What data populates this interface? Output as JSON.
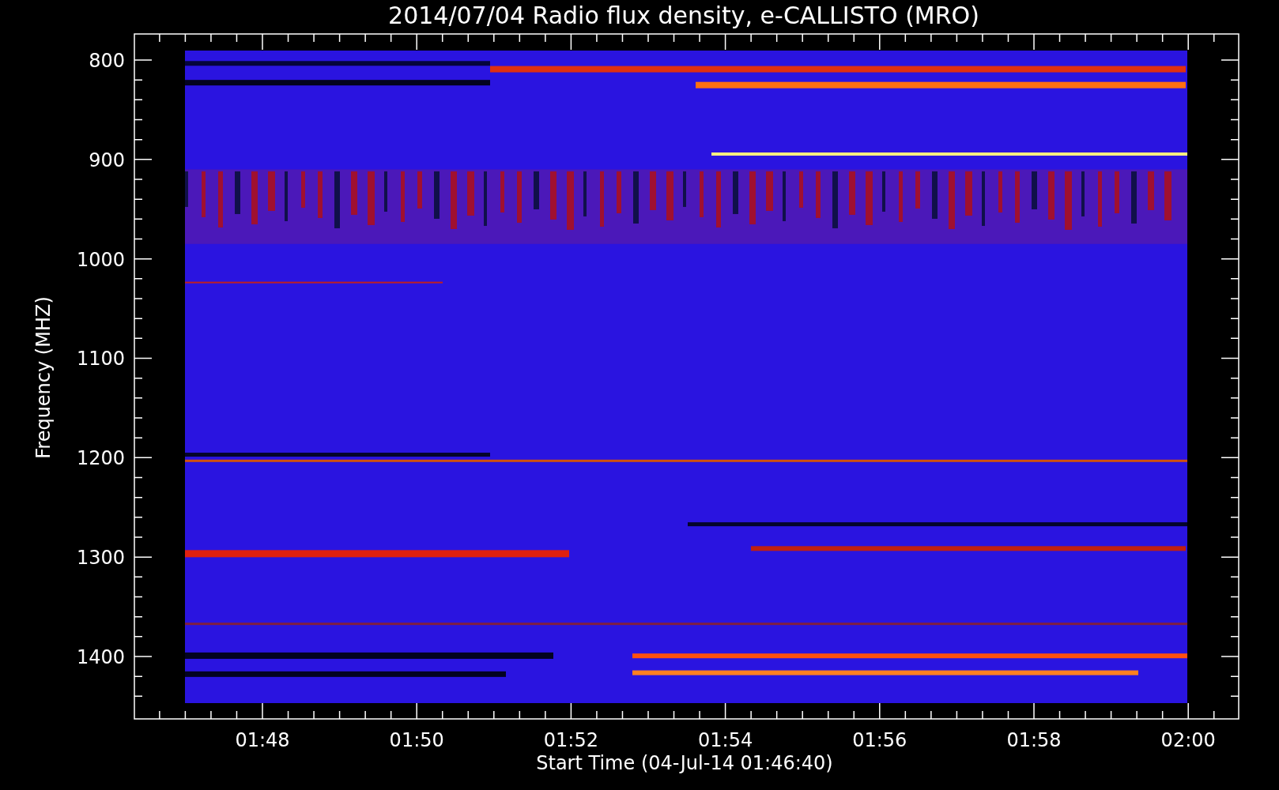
{
  "title": "2014/07/04  Radio flux density, e-CALLISTO (MRO)",
  "ylabel": "Frequency (MHZ)",
  "xlabel": "Start Time (04-Jul-14 01:46:40)",
  "yticks": [
    "800",
    "900",
    "1000",
    "1100",
    "1200",
    "1300",
    "1400"
  ],
  "xticks": [
    "01:48",
    "01:50",
    "01:52",
    "01:54",
    "01:56",
    "01:58",
    "02:00"
  ]
}
